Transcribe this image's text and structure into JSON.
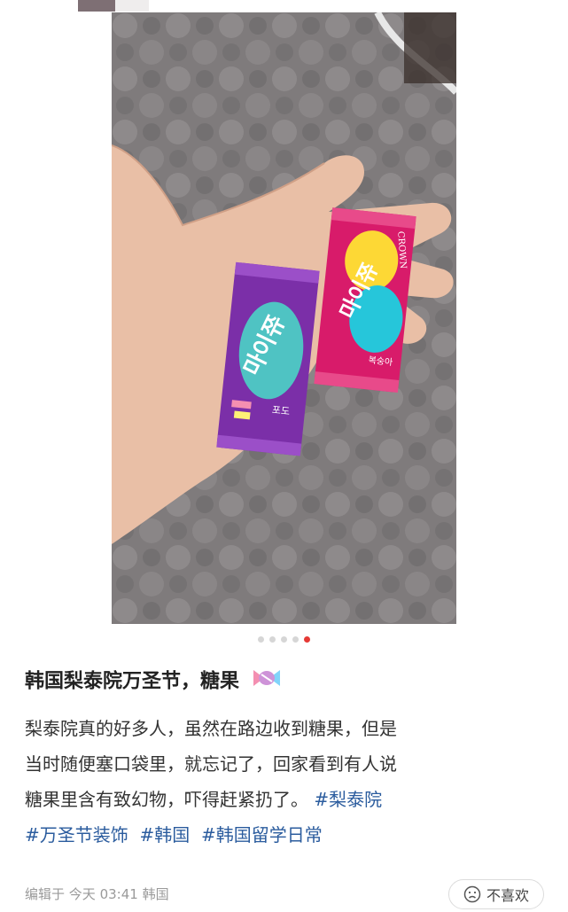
{
  "post": {
    "title": "韩国梨泰院万圣节，糖果",
    "title_emoji": "candy-icon",
    "body": {
      "lines": [
        "梨泰院真的好多人，虽然在路边收到糖果，但是",
        "当时随便塞口袋里，就忘记了，回家看到有人说",
        "糖果里含有致幻物，吓得赶紧扔了。"
      ],
      "tags": [
        "#梨泰院",
        "#万圣节装饰",
        "#韩国",
        "#韩国留学日常"
      ]
    },
    "meta": {
      "edit_label": "编辑于",
      "time": "今天 03:41",
      "location": "韩国"
    },
    "dislike_label": "不喜欢"
  },
  "carousel": {
    "total": 5,
    "active_index": 5
  },
  "photo": {
    "description_icon": "photo-of-hand-holding-candies",
    "candy_text_1": "마이쮸",
    "candy_text_2": "마이쮸",
    "brand": "CROWN",
    "flavor_1": "포도",
    "flavor_2": "복숭아"
  },
  "colors": {
    "tag": "#2b5c9e",
    "active_dot": "#e53935",
    "purple_candy": "#7b2fa8",
    "pink_candy": "#d81b6a"
  }
}
